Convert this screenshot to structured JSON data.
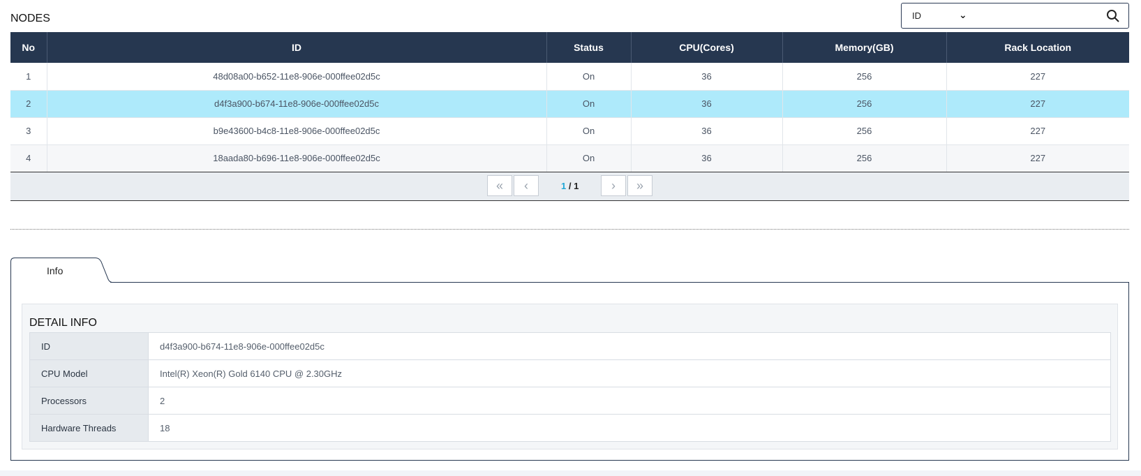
{
  "page": {
    "title": "NODES"
  },
  "search": {
    "field": "ID",
    "placeholder": ""
  },
  "table": {
    "headers": [
      "No",
      "ID",
      "Status",
      "CPU(Cores)",
      "Memory(GB)",
      "Rack Location"
    ],
    "rows": [
      [
        "1",
        "48d08a00-b652-11e8-906e-000ffee02d5c",
        "On",
        "36",
        "256",
        "227"
      ],
      [
        "2",
        "d4f3a900-b674-11e8-906e-000ffee02d5c",
        "On",
        "36",
        "256",
        "227"
      ],
      [
        "3",
        "b9e43600-b4c8-11e8-906e-000ffee02d5c",
        "On",
        "36",
        "256",
        "227"
      ],
      [
        "4",
        "18aada80-b696-11e8-906e-000ffee02d5c",
        "On",
        "36",
        "256",
        "227"
      ]
    ],
    "selected_row_no": "2"
  },
  "pager": {
    "current": "1",
    "separator": " / ",
    "total": "1"
  },
  "tabs": [
    {
      "label": "Info"
    }
  ],
  "detail": {
    "title": "DETAIL INFO",
    "rows": [
      {
        "key": "ID",
        "value": "d4f3a900-b674-11e8-906e-000ffee02d5c"
      },
      {
        "key": "CPU Model",
        "value": "Intel(R) Xeon(R) Gold 6140 CPU @ 2.30GHz"
      },
      {
        "key": "Processors",
        "value": "2"
      },
      {
        "key": "Hardware Threads",
        "value": "18"
      }
    ]
  },
  "colors": {
    "header_bg": "#263750",
    "selected_row": "#aeeafb",
    "accent": "#1fa6d6"
  }
}
